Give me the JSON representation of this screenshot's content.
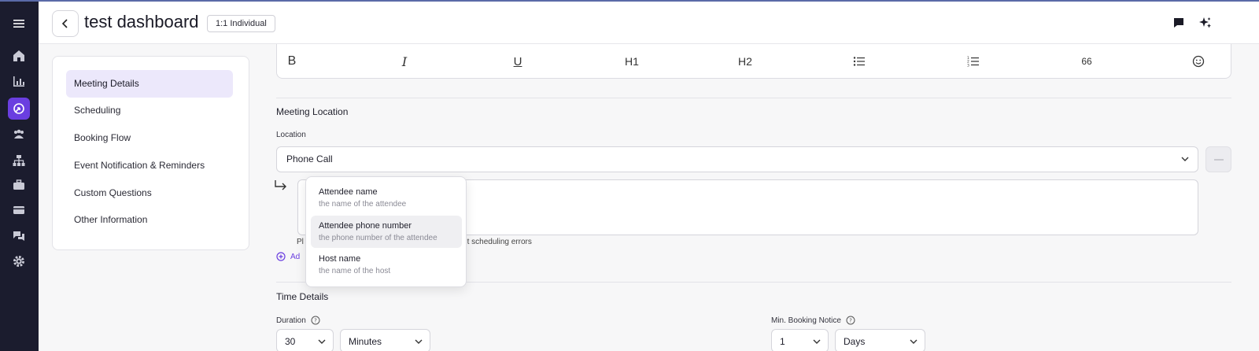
{
  "header": {
    "title": "test dashboard",
    "badge": "1:1 Individual"
  },
  "sidebar_nav": {
    "items": [
      {
        "label": "Meeting Details",
        "active": true
      },
      {
        "label": "Scheduling",
        "active": false
      },
      {
        "label": "Booking Flow",
        "active": false
      },
      {
        "label": "Event Notification & Reminders",
        "active": false
      },
      {
        "label": "Custom Questions",
        "active": false
      },
      {
        "label": "Other Information",
        "active": false
      }
    ]
  },
  "toolbar": {
    "bold": "B",
    "italic": "I",
    "underline": "U",
    "h1": "H1",
    "h2": "H2",
    "quote": "66"
  },
  "location": {
    "section_title": "Meeting Location",
    "label": "Location",
    "value": "Phone Call",
    "helper_prefix": "Pl",
    "helper_suffix": "to prevent scheduling errors",
    "add_link": "Ad"
  },
  "variable_menu": {
    "options": [
      {
        "title": "Attendee name",
        "subtitle": "the name of the attendee"
      },
      {
        "title": "Attendee phone number",
        "subtitle": "the phone number of the attendee"
      },
      {
        "title": "Host name",
        "subtitle": "the name of the host"
      }
    ]
  },
  "time_details": {
    "section_title": "Time Details",
    "duration_label": "Duration",
    "duration_value": "30",
    "duration_unit": "Minutes",
    "min_notice_label": "Min. Booking Notice",
    "min_notice_value": "1",
    "min_notice_unit": "Days"
  },
  "colors": {
    "accent": "#6a3ee0",
    "rail_bg": "#1b1c2e",
    "active_nav_bg": "#ece8fb"
  }
}
